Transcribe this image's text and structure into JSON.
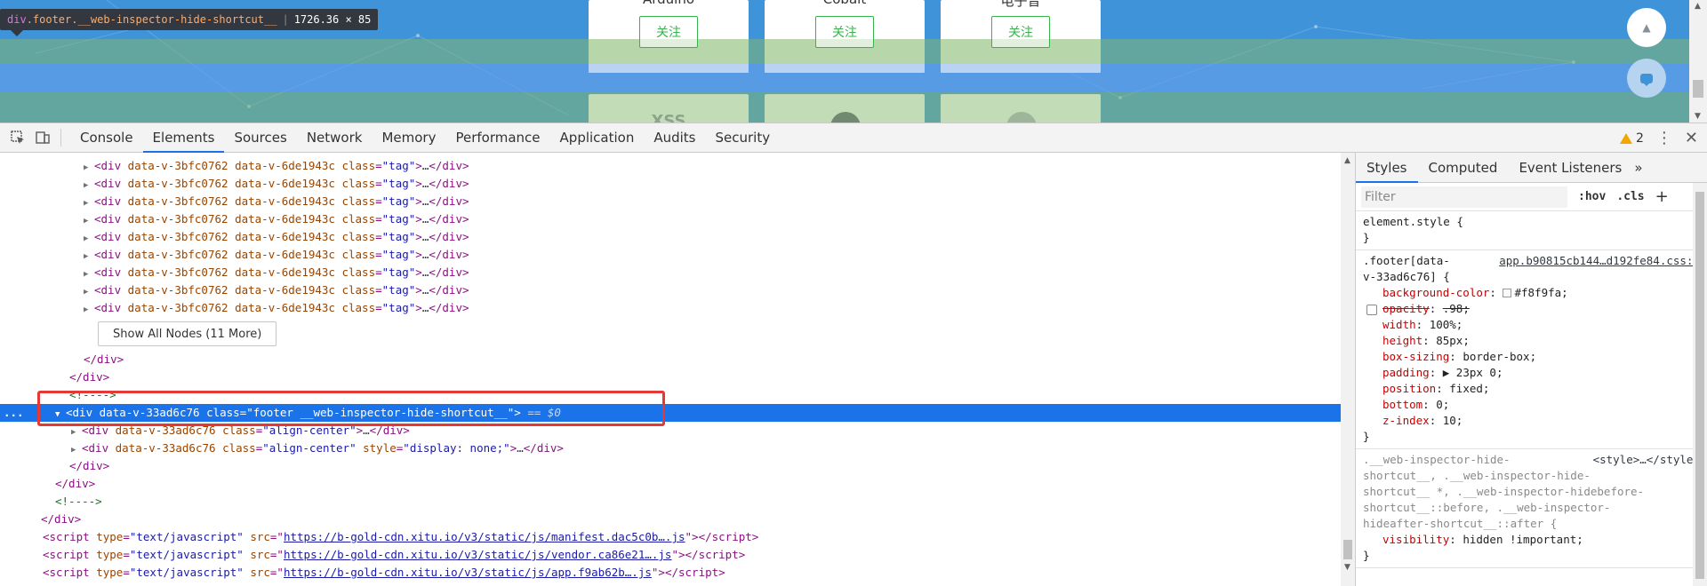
{
  "preview": {
    "tooltip": {
      "tag": "div",
      "class_name": ".footer.__web-inspector-hide-shortcut__",
      "size": "1726.36 × 85"
    },
    "cards": [
      {
        "title": "Arduino",
        "follow_label": "关注"
      },
      {
        "title": "Cobalt",
        "follow_label": "关注"
      },
      {
        "title": "电子音",
        "follow_label": "关注"
      }
    ],
    "second_row_marks": [
      "XSS",
      "",
      ""
    ],
    "scroll_top_icon": "arrow-up-icon",
    "chat_icon": "chat-bubble-icon"
  },
  "toolbar": {
    "tabs": [
      "Console",
      "Elements",
      "Sources",
      "Network",
      "Memory",
      "Performance",
      "Application",
      "Audits",
      "Security"
    ],
    "active_tab": "Elements",
    "warning_count": "2"
  },
  "elements": {
    "tag_line": {
      "tag": "div",
      "attr1": "data-v-3bfc0762",
      "attr2": "data-v-6de1943c",
      "class_attr": "class",
      "class_val": "\"tag\"",
      "ellipsis": "…",
      "close": "</div>"
    },
    "show_all_label": "Show All Nodes (11 More)",
    "close_div": "</div>",
    "comment": "<!---->",
    "selected_line": {
      "dots": "...",
      "tag": "div",
      "attr1": "data-v-33ad6c76",
      "class_attr": "class",
      "class_val": "\"footer __web-inspector-hide-shortcut__\"",
      "eq": "== $0"
    },
    "child1": {
      "tag": "div",
      "attr1": "data-v-33ad6c76",
      "class_attr": "class",
      "class_val": "\"align-center\"",
      "ellipsis": "…",
      "close": "</div>"
    },
    "child2": {
      "tag": "div",
      "attr1": "data-v-33ad6c76",
      "class_attr": "class",
      "class_val": "\"align-center\"",
      "style_attr": "style",
      "style_val": "\"display: none;\"",
      "ellipsis": "…",
      "close": "</div>"
    },
    "scripts": [
      {
        "type_val": "\"text/javascript\"",
        "src": "https://b-gold-cdn.xitu.io/v3/static/js/manifest.dac5c0b….js"
      },
      {
        "type_val": "\"text/javascript\"",
        "src": "https://b-gold-cdn.xitu.io/v3/static/js/vendor.ca86e21….js"
      },
      {
        "type_val": "\"text/javascript\"",
        "src": "https://b-gold-cdn.xitu.io/v3/static/js/app.f9ab62b….js"
      }
    ]
  },
  "styles": {
    "tabs": [
      "Styles",
      "Computed",
      "Event Listeners"
    ],
    "active_tab": "Styles",
    "more": "»",
    "filter_placeholder": "Filter",
    "hov_label": ":hov",
    "cls_label": ".cls",
    "add_label": "+",
    "element_style": {
      "selector": "element.style {",
      "close": "}"
    },
    "footer_rule": {
      "selector_line1": ".footer[data-",
      "selector_line2": "v-33ad6c76] {",
      "source": "app.b90815cb144…d192fe84.css:1",
      "decls": [
        {
          "prop": "background-color",
          "value": "#f8f9fa;",
          "swatch": "#f8f9fa",
          "struck": false,
          "checkbox": false
        },
        {
          "prop": "opacity",
          "value": ".98;",
          "struck": true,
          "checkbox": true
        },
        {
          "prop": "width",
          "value": "100%;",
          "struck": false,
          "checkbox": false
        },
        {
          "prop": "height",
          "value": "85px;",
          "struck": false,
          "checkbox": false
        },
        {
          "prop": "box-sizing",
          "value": "border-box;",
          "struck": false,
          "checkbox": false
        },
        {
          "prop": "padding",
          "value": "▶ 23px 0;",
          "struck": false,
          "checkbox": false
        },
        {
          "prop": "position",
          "value": "fixed;",
          "struck": false,
          "checkbox": false
        },
        {
          "prop": "bottom",
          "value": "0;",
          "struck": false,
          "checkbox": false
        },
        {
          "prop": "z-index",
          "value": "10;",
          "struck": false,
          "checkbox": false
        }
      ],
      "close": "}"
    },
    "hide_rule": {
      "selector_lines": [
        ".__web-inspector-hide-",
        "shortcut__, .__web-inspector-hide-",
        "shortcut__ *, .__web-inspector-hidebefore-",
        "shortcut__::before, .__web-inspector-",
        "hideafter-shortcut__::after {"
      ],
      "source": "<style>…</style>",
      "decls": [
        {
          "prop": "visibility",
          "value": "hidden !important;"
        }
      ],
      "close": "}"
    }
  },
  "colors": {
    "selection": "#1a73e8",
    "highlight_box": "#e53935",
    "follow_green": "#37b24d"
  }
}
